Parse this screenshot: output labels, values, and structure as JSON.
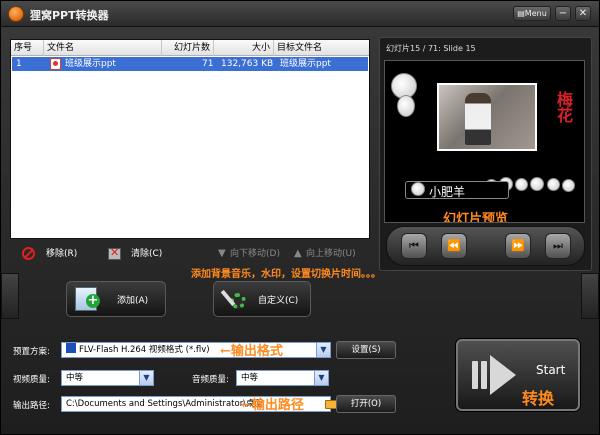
{
  "window": {
    "title": "狸窝PPT转换器",
    "menu_label": "Menu",
    "minimize_glyph": "−",
    "close_glyph": "✕"
  },
  "file_list": {
    "columns": [
      "序号",
      "文件名",
      "幻灯片数",
      "大小",
      "目标文件名"
    ],
    "rows": [
      {
        "index": "1",
        "filename": "班级展示ppt",
        "slides": "71",
        "size": "132,763 KB",
        "target": "班级展示ppt"
      }
    ]
  },
  "list_toolbar": {
    "remove_label": "移除(R)",
    "clear_label": "清除(C)",
    "move_down_label": "向下移动(D)",
    "move_up_label": "向上移动(U)"
  },
  "preview": {
    "label": "幻灯片15 / 71: Slide 15",
    "slide_caption": "小肥羊",
    "overlay_text": "幻灯片预览",
    "slide_deco_text": "梅花",
    "seek_fraction": 0.15
  },
  "actions": {
    "add_label": "添加(A)",
    "custom_label": "自定义(C)"
  },
  "hints": {
    "custom_hint": "添加背景音乐，水印，设置切换片时间。。。",
    "format_hint": "←输出格式",
    "path_hint": "←输出路径"
  },
  "settings": {
    "preset_label": "预置方案:",
    "preset_value": "FLV-Flash H.264 视频格式 (*.flv)",
    "settings_button": "设置(S)",
    "video_quality_label": "视频质量:",
    "video_quality_value": "中等",
    "audio_quality_label": "音频质量:",
    "audio_quality_value": "中等",
    "output_path_label": "输出路径:",
    "output_path_value": "C:\\Documents and Settings\\Administrator\\桌面",
    "open_button": "打开(O)"
  },
  "start": {
    "label": "Start",
    "hint": "转换"
  },
  "colors": {
    "accent_orange": "#ff8a1e",
    "selection_blue": "#3b6fd4",
    "panel_dark": "#2a2a2a"
  }
}
